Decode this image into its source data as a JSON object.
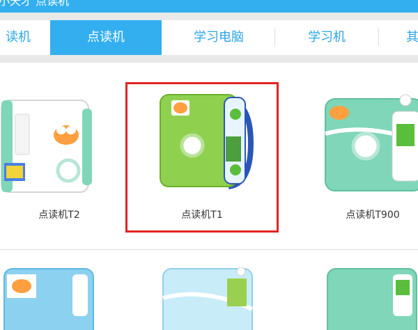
{
  "header": {
    "title_partial": "小天才 点读机"
  },
  "tabs": [
    {
      "label": "读机",
      "active": false
    },
    {
      "label": "点读机",
      "active": true
    },
    {
      "label": "学习电脑",
      "active": false
    },
    {
      "label": "学习机",
      "active": false
    },
    {
      "label": "其",
      "active": false
    }
  ],
  "products": [
    {
      "label": "点读机T2",
      "selected": false
    },
    {
      "label": "点读机T1",
      "selected": true
    },
    {
      "label": "点读机T900",
      "selected": false
    }
  ],
  "colors": {
    "brand_blue": "#33aff0",
    "tab_text_blue": "#2aa6e3",
    "highlight_red": "#e32222",
    "device_green_light": "#8fd14f",
    "device_mint": "#7fd6b8",
    "device_sky": "#8cd1f0"
  }
}
